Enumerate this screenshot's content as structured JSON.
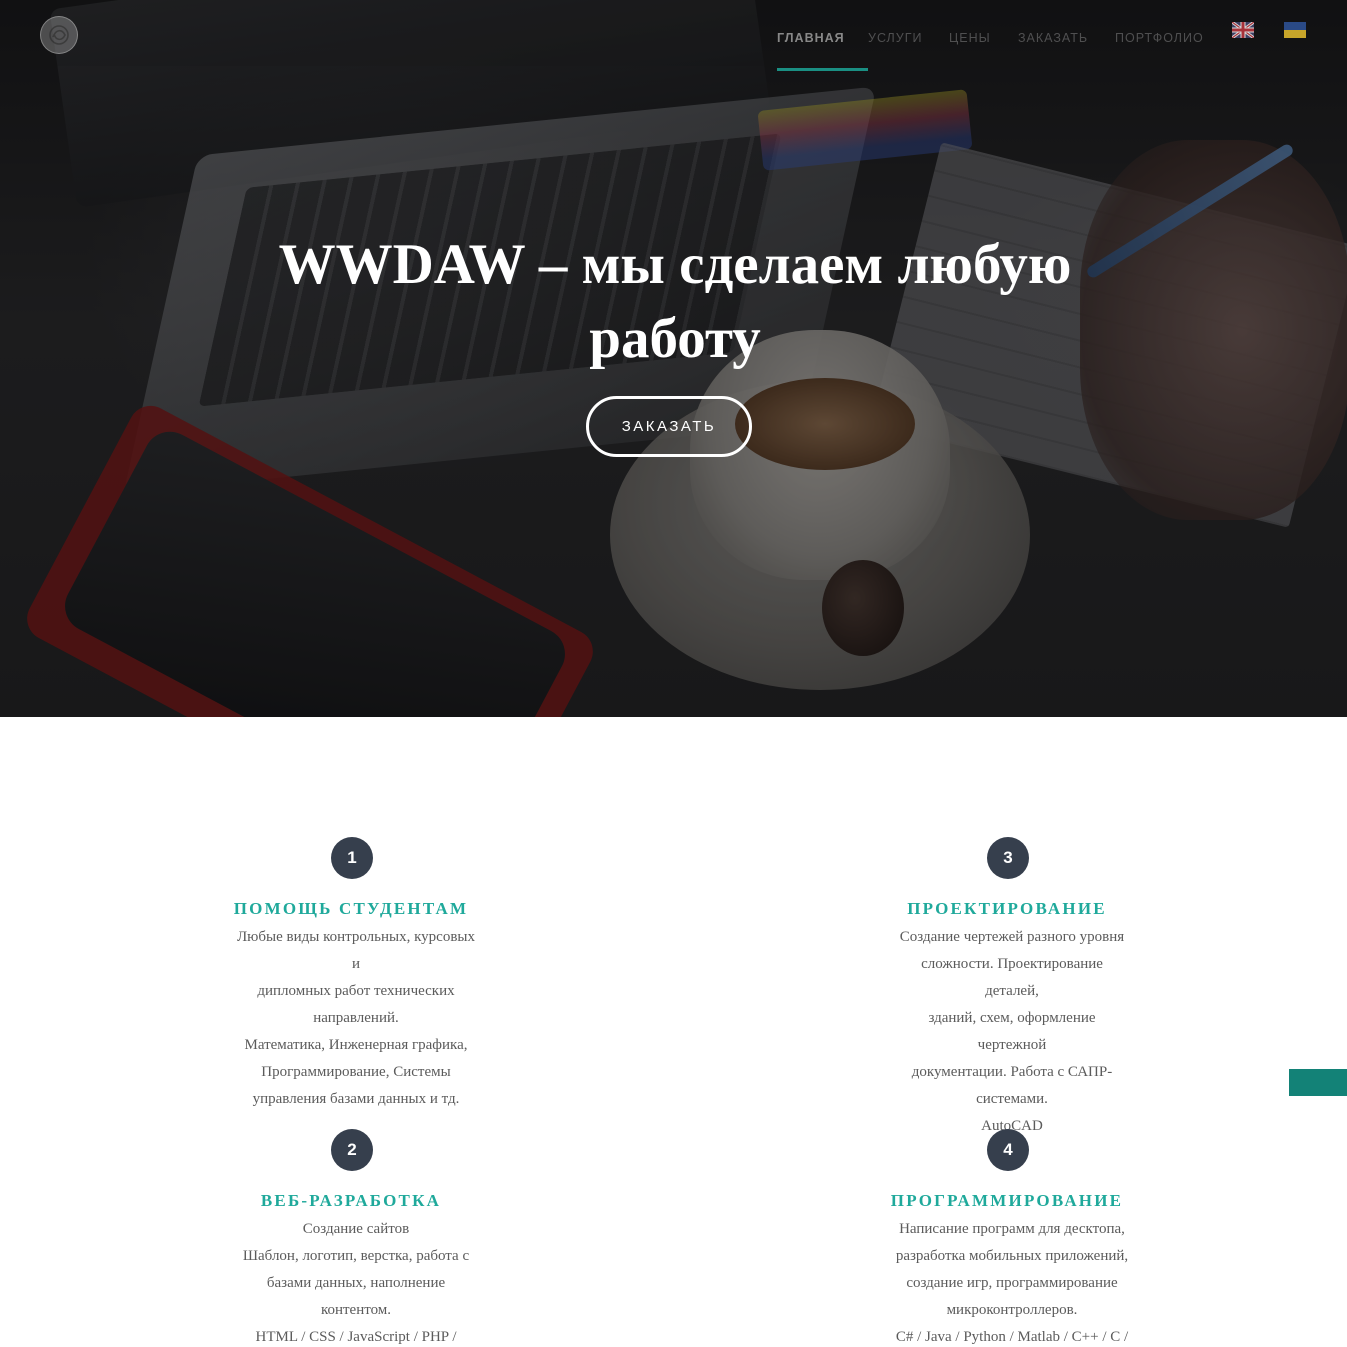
{
  "nav": {
    "logo_alt": "",
    "items": [
      {
        "label": "ГЛАВНАЯ",
        "active": true
      },
      {
        "label": "УСЛУГИ",
        "active": false
      },
      {
        "label": "ЦЕНЫ",
        "active": false
      },
      {
        "label": "ЗАКАЗАТЬ",
        "active": false
      },
      {
        "label": "ПОРТФОЛИО",
        "active": false
      }
    ],
    "languages": [
      "uk-flag-icon",
      "ua-flag-icon"
    ]
  },
  "hero": {
    "title_line1": "WWDAW – мы сделаем любую",
    "title_line2": "работу",
    "button_label": "ЗАКАЗАТЬ"
  },
  "services": [
    {
      "number": "1",
      "title": "ПОМОЩЬ СТУДЕНТАМ",
      "lines": [
        "Любые виды контрольных, курсовых и",
        "дипломных работ технических",
        "направлений.",
        "Математика, Инженерная графика,",
        "Программирование, Системы",
        "управления базами данных и тд."
      ]
    },
    {
      "number": "2",
      "title": "ВЕБ-РАЗРАБОТКА",
      "lines": [
        "Создание сайтов",
        "Шаблон, логотип, верстка, работа с",
        "базами данных, наполнение",
        "контентом.",
        "HTML / CSS / JavaScript / PHP / MySql"
      ]
    },
    {
      "number": "3",
      "title": "ПРОЕКТИРОВАНИЕ",
      "lines": [
        "Создание чертежей разного уровня",
        "сложности. Проектирование деталей,",
        "зданий, схем, оформление чертежной",
        "документации. Работа с САПР-",
        "системами.",
        "AutoCAD"
      ]
    },
    {
      "number": "4",
      "title": "ПРОГРАММИРОВАНИЕ",
      "lines": [
        "Написание программ для десктопа,",
        "разработка мобильных приложений,",
        "создание игр, программирование",
        "микроконтроллеров.",
        "C# / Java / Python / Matlab / C++ / C /"
      ]
    }
  ],
  "colors": {
    "accent": "#1fa99b",
    "nav_underline": "#1a8f83",
    "badge": "#363f4d",
    "side_tab": "#138277"
  }
}
